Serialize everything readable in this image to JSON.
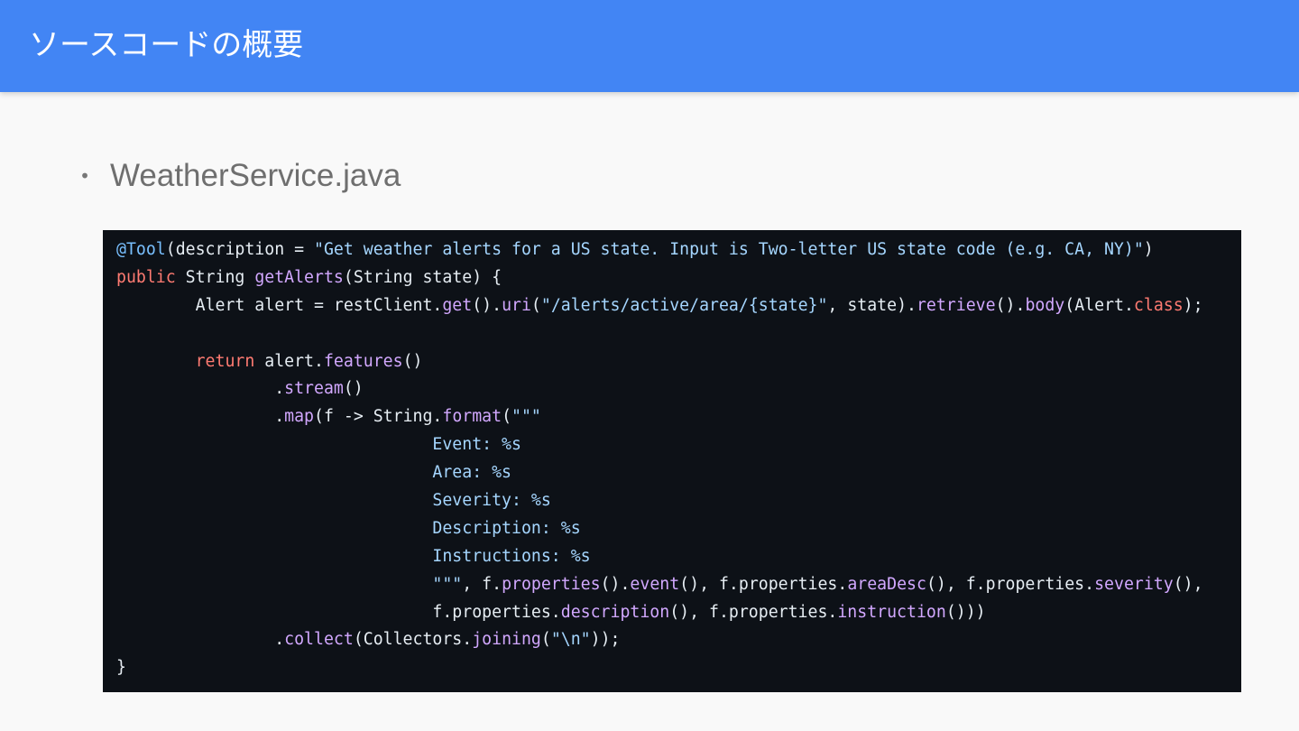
{
  "slide": {
    "title": "ソースコードの概要",
    "bullet_marker": "•",
    "bullet_text": "WeatherService.java"
  },
  "code": {
    "lines": [
      [
        {
          "t": "@Tool",
          "c": "ann"
        },
        {
          "t": "(description = ",
          "c": "plain"
        },
        {
          "t": "\"Get weather alerts for a US state. Input is Two-letter US state code (e.g. CA, NY)\"",
          "c": "str"
        },
        {
          "t": ")",
          "c": "plain"
        }
      ],
      [
        {
          "t": "public",
          "c": "kw"
        },
        {
          "t": " String ",
          "c": "plain"
        },
        {
          "t": "getAlerts",
          "c": "fn"
        },
        {
          "t": "(String state) {",
          "c": "plain"
        }
      ],
      [
        {
          "t": "        Alert alert = restClient.",
          "c": "plain"
        },
        {
          "t": "get",
          "c": "fn"
        },
        {
          "t": "().",
          "c": "plain"
        },
        {
          "t": "uri",
          "c": "fn"
        },
        {
          "t": "(",
          "c": "plain"
        },
        {
          "t": "\"/alerts/active/area/{state}\"",
          "c": "str"
        },
        {
          "t": ", state).",
          "c": "plain"
        },
        {
          "t": "retrieve",
          "c": "fn"
        },
        {
          "t": "().",
          "c": "plain"
        },
        {
          "t": "body",
          "c": "fn"
        },
        {
          "t": "(Alert.",
          "c": "plain"
        },
        {
          "t": "class",
          "c": "kw"
        },
        {
          "t": ");",
          "c": "plain"
        }
      ],
      [],
      [
        {
          "t": "        ",
          "c": "plain"
        },
        {
          "t": "return",
          "c": "kw"
        },
        {
          "t": " alert.",
          "c": "plain"
        },
        {
          "t": "features",
          "c": "fn"
        },
        {
          "t": "()",
          "c": "plain"
        }
      ],
      [
        {
          "t": "                .",
          "c": "plain"
        },
        {
          "t": "stream",
          "c": "fn"
        },
        {
          "t": "()",
          "c": "plain"
        }
      ],
      [
        {
          "t": "                .",
          "c": "plain"
        },
        {
          "t": "map",
          "c": "fn"
        },
        {
          "t": "(f -> String.",
          "c": "plain"
        },
        {
          "t": "format",
          "c": "fn"
        },
        {
          "t": "(",
          "c": "plain"
        },
        {
          "t": "\"\"\"",
          "c": "str"
        }
      ],
      [
        {
          "t": "                                Event: %s",
          "c": "str"
        }
      ],
      [
        {
          "t": "                                Area: %s",
          "c": "str"
        }
      ],
      [
        {
          "t": "                                Severity: %s",
          "c": "str"
        }
      ],
      [
        {
          "t": "                                Description: %s",
          "c": "str"
        }
      ],
      [
        {
          "t": "                                Instructions: %s",
          "c": "str"
        }
      ],
      [
        {
          "t": "                                \"\"\"",
          "c": "str"
        },
        {
          "t": ", f.",
          "c": "plain"
        },
        {
          "t": "properties",
          "c": "fn"
        },
        {
          "t": "().",
          "c": "plain"
        },
        {
          "t": "event",
          "c": "fn"
        },
        {
          "t": "(), f.properties.",
          "c": "plain"
        },
        {
          "t": "areaDesc",
          "c": "fn"
        },
        {
          "t": "(), f.properties.",
          "c": "plain"
        },
        {
          "t": "severity",
          "c": "fn"
        },
        {
          "t": "(),",
          "c": "plain"
        }
      ],
      [
        {
          "t": "                                f.properties.",
          "c": "plain"
        },
        {
          "t": "description",
          "c": "fn"
        },
        {
          "t": "(), f.properties.",
          "c": "plain"
        },
        {
          "t": "instruction",
          "c": "fn"
        },
        {
          "t": "()))",
          "c": "plain"
        }
      ],
      [
        {
          "t": "                .",
          "c": "plain"
        },
        {
          "t": "collect",
          "c": "fn"
        },
        {
          "t": "(Collectors.",
          "c": "plain"
        },
        {
          "t": "joining",
          "c": "fn"
        },
        {
          "t": "(",
          "c": "plain"
        },
        {
          "t": "\"\\n\"",
          "c": "str"
        },
        {
          "t": "));",
          "c": "plain"
        }
      ],
      [
        {
          "t": "}",
          "c": "plain"
        }
      ]
    ]
  },
  "colors": {
    "header_bg": "#4285f4",
    "slide_bg": "#f9f9f9",
    "code_bg": "#0d1117",
    "code_plain": "#e6edf3",
    "code_annotation": "#79c0ff",
    "code_string": "#a5d6ff",
    "code_keyword": "#ff7b72",
    "code_function": "#d2a8ff"
  }
}
